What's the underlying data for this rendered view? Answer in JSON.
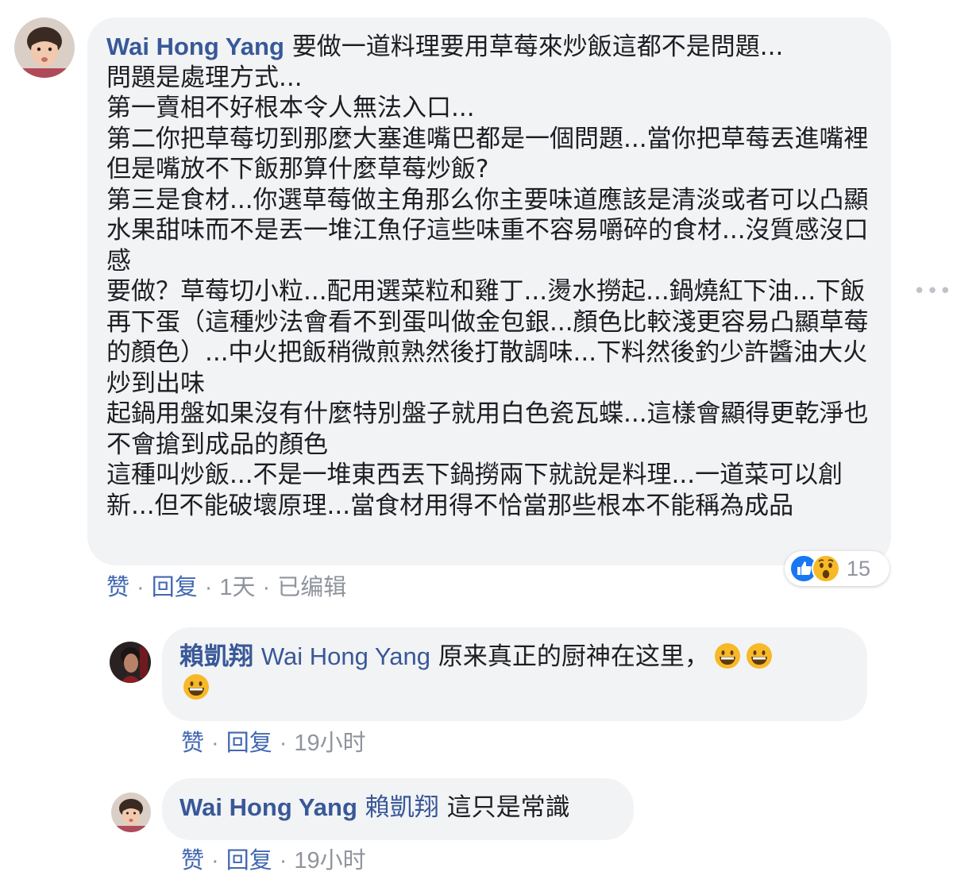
{
  "comments": [
    {
      "author": "Wai Hong Yang",
      "lines": [
        "要做一道料理要用草莓來炒飯這都不是問題...",
        "問題是處理方式...",
        "第一賣相不好根本令人無法入口...",
        "第二你把草莓切到那麼大塞進嘴巴都是一個問題...當你把草莓丟進嘴裡但是嘴放不下飯那算什麼草莓炒飯?",
        "第三是食材...你選草莓做主角那么你主要味道應該是清淡或者可以凸顯水果甜味而不是丟一堆江魚仔這些味重不容易嚼碎的食材...沒質感沒口感",
        "要做？草莓切小粒...配用選菜粒和雞丁...燙水撈起...鍋燒紅下油...下飯再下蛋（這種炒法會看不到蛋叫做金包銀...顏色比較淺更容易凸顯草莓的顏色）...中火把飯稍微煎熟然後打散調味...下料然後釣少許醬油大火炒到出味",
        "起鍋用盤如果沒有什麼特別盤子就用白色瓷瓦蝶...這樣會顯得更乾淨也不會搶到成品的顏色",
        "這種叫炒飯...不是一堆東西丟下鍋撈兩下就說是料理...一道菜可以創新...但不能破壞原理...當食材用得不恰當那些根本不能稱為成品"
      ],
      "actions": {
        "like": "赞",
        "reply": "回复",
        "time": "1天",
        "edited": "已编辑"
      },
      "reactions": {
        "count": "15",
        "icons": [
          "like-icon",
          "wow-icon"
        ]
      },
      "more_icon": "more-options-icon"
    }
  ],
  "replies": [
    {
      "author": "賴凱翔",
      "tag": "Wai Hong Yang",
      "text": "原来真正的厨神在这里，",
      "emojis": [
        "grinning-emoji",
        "grinning-emoji",
        "grinning-emoji"
      ],
      "actions": {
        "like": "赞",
        "reply": "回复",
        "time": "19小时"
      }
    },
    {
      "author": "Wai Hong Yang",
      "tag": "賴凱翔",
      "text": "這只是常識",
      "actions": {
        "like": "赞",
        "reply": "回复",
        "time": "19小时"
      }
    }
  ],
  "colors": {
    "link": "#385898",
    "action_link": "#4267b2",
    "meta": "#90949c",
    "bubble": "#f2f3f5",
    "like_blue": "#1877f2",
    "wow_yellow": "#f7b928"
  }
}
